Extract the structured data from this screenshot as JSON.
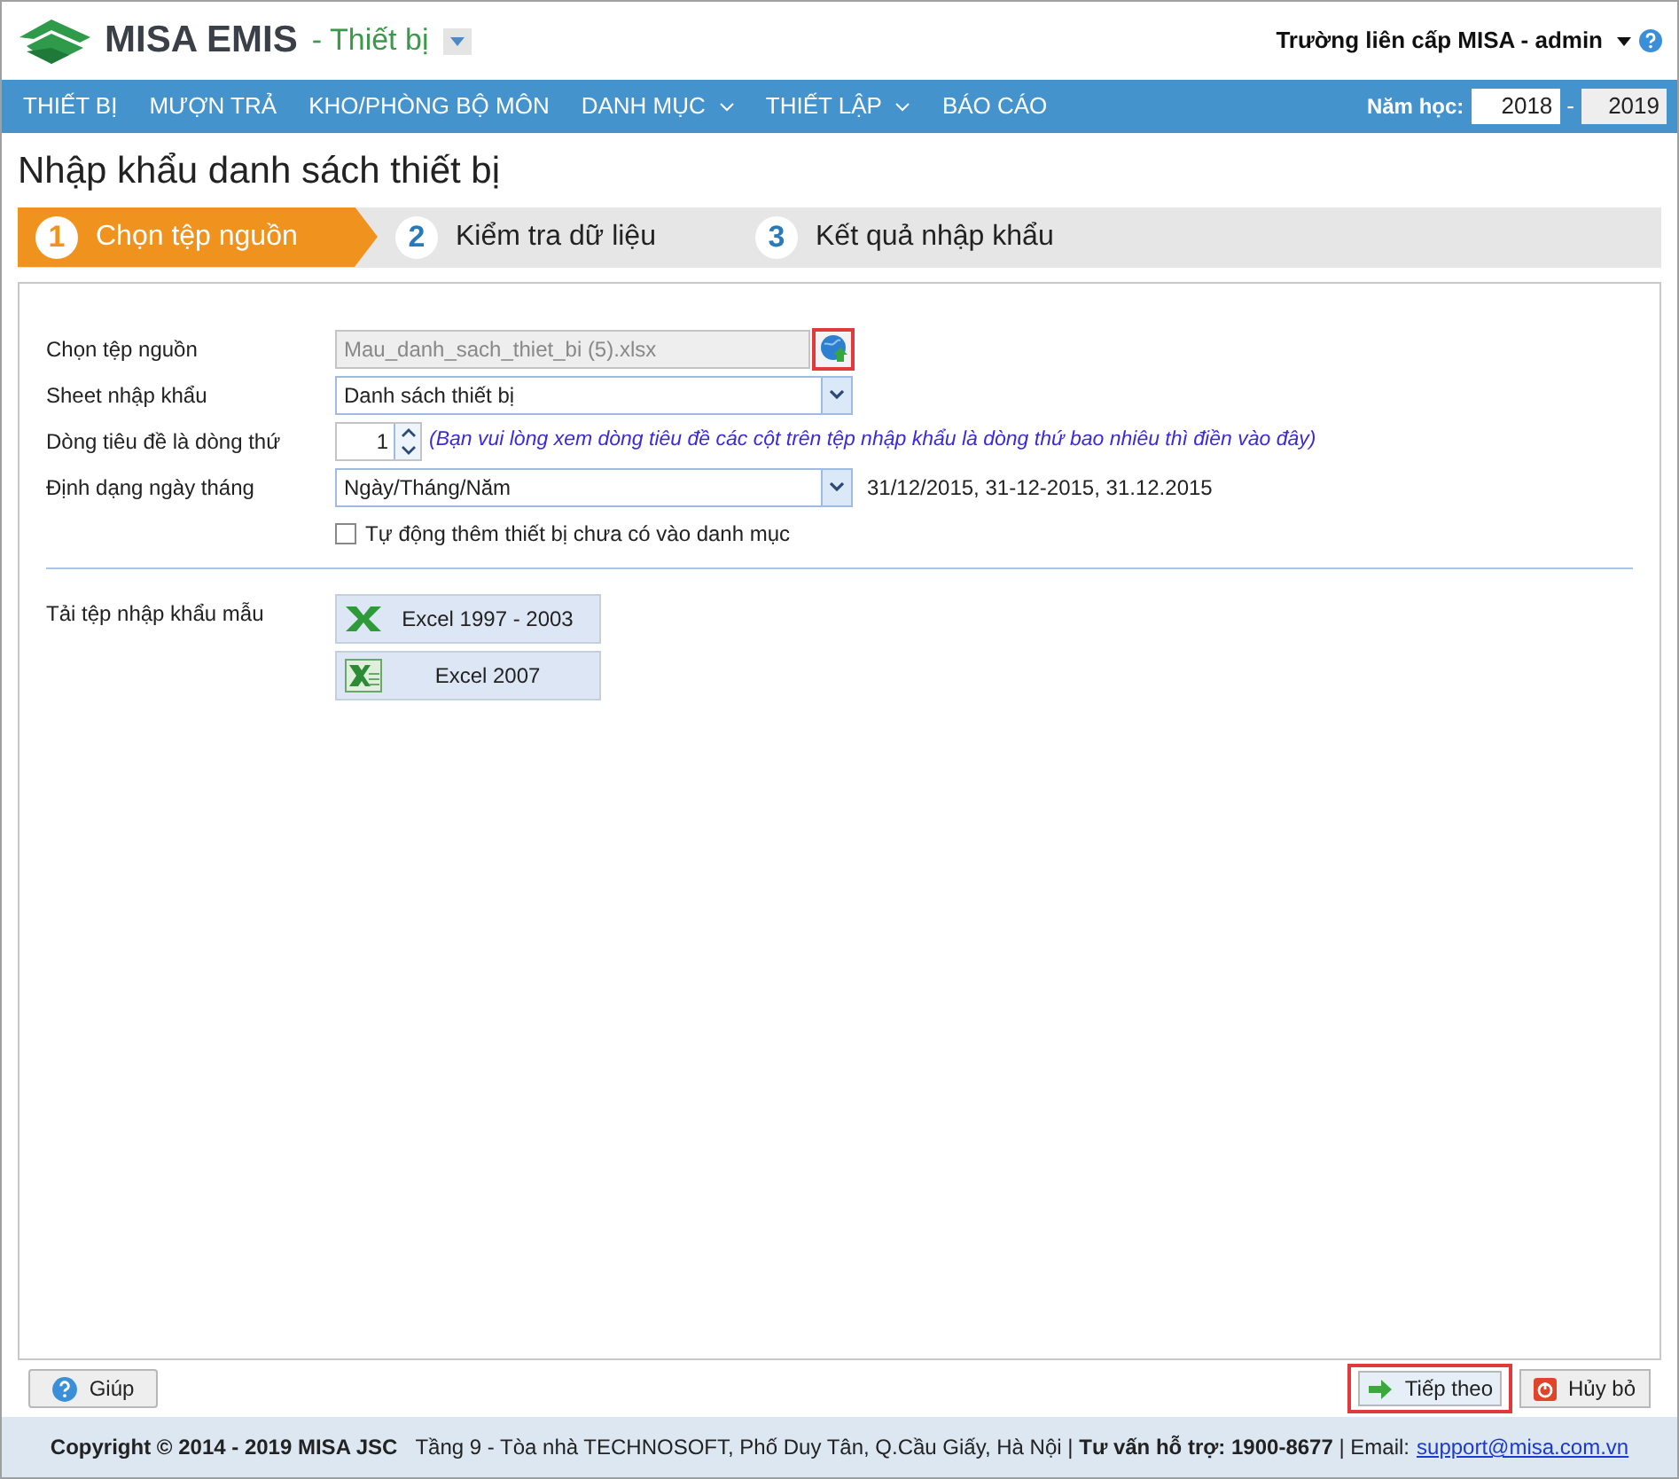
{
  "header": {
    "brand": "MISA EMIS",
    "module": "- Thiết bị",
    "user": "Trường liên cấp MISA - admin"
  },
  "nav": {
    "items": [
      {
        "label": "THIẾT BỊ",
        "dropdown": false
      },
      {
        "label": "MƯỢN TRẢ",
        "dropdown": false
      },
      {
        "label": "KHO/PHÒNG BỘ MÔN",
        "dropdown": false
      },
      {
        "label": "DANH MỤC",
        "dropdown": true
      },
      {
        "label": "THIẾT LẬP",
        "dropdown": true
      },
      {
        "label": "BÁO CÁO",
        "dropdown": false
      }
    ],
    "year_label": "Năm học:",
    "year_from": "2018",
    "year_sep": "-",
    "year_to": "2019"
  },
  "page_title": "Nhập khẩu danh sách thiết bị",
  "steps": [
    {
      "number": "1",
      "label": "Chọn tệp nguồn",
      "selected": true
    },
    {
      "number": "2",
      "label": "Kiểm tra dữ liệu",
      "selected": false
    },
    {
      "number": "3",
      "label": "Kết quả nhập khẩu",
      "selected": false
    }
  ],
  "form": {
    "source_label": "Chọn tệp nguồn",
    "source_value": "Mau_danh_sach_thiet_bi (5).xlsx",
    "upload_highlighted": true,
    "sheet_label": "Sheet nhập khẩu",
    "sheet_value": "Danh sách thiết bị",
    "header_row_label": "Dòng tiêu đề là dòng thứ",
    "header_row_value": "1",
    "header_row_hint": "(Bạn vui lòng xem dòng tiêu đề các cột trên tệp nhập khẩu là dòng thứ bao nhiêu thì điền vào đây)",
    "date_label": "Định dạng ngày tháng",
    "date_value": "Ngày/Tháng/Năm",
    "date_examples": "31/12/2015, 31-12-2015, 31.12.2015",
    "auto_add": {
      "label": "Tự động thêm thiết bị chưa có vào danh mục",
      "checked": false
    },
    "template_label": "Tải tệp nhập khẩu mẫu",
    "templates": [
      {
        "label": "Excel 1997 - 2003",
        "kind": "xls"
      },
      {
        "label": "Excel 2007",
        "kind": "xlsx"
      }
    ]
  },
  "buttons": {
    "help": "Giúp",
    "next": "Tiếp theo",
    "next_highlighted": true,
    "cancel": "Hủy bỏ"
  },
  "footer": {
    "copyright": "Copyright © 2014 - 2019 MISA JSC",
    "address": "Tầng 9 - Tòa nhà TECHNOSOFT, Phố Duy Tân, Q.Cầu Giấy, Hà Nội | **Tư vấn hỗ trợ: 1900-8677** | Email:",
    "email": "support@misa.com.vn"
  }
}
